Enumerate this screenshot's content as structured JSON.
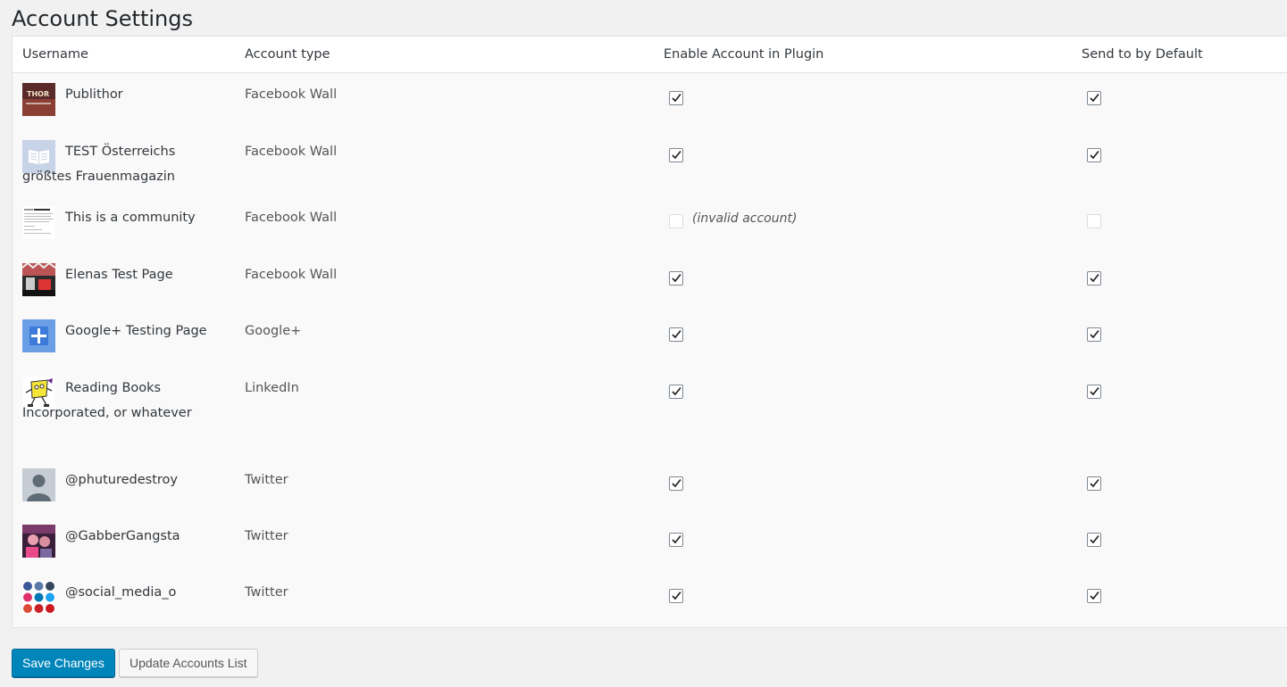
{
  "page": {
    "title": "Account Settings"
  },
  "table": {
    "headers": {
      "username": "Username",
      "account_type": "Account type",
      "enable": "Enable Account in Plugin",
      "default": "Send to by Default"
    },
    "rows": [
      {
        "name": "Publithor",
        "type": "Facebook Wall",
        "enabled": true,
        "default": true,
        "avatar": "thor-poster-avatar"
      },
      {
        "name": "TEST Österreichs größtes Frauenmagazin",
        "type": "Facebook Wall",
        "enabled": true,
        "default": true,
        "avatar": "book-icon-avatar"
      },
      {
        "name": "This is a community",
        "type": "Facebook Wall",
        "enabled": false,
        "default": false,
        "invalid_note": "(invalid account)",
        "avatar": "document-page-avatar"
      },
      {
        "name": "Elenas Test Page",
        "type": "Facebook Wall",
        "enabled": true,
        "default": true,
        "avatar": "photo-avatar"
      },
      {
        "name": "Google+ Testing Page",
        "type": "Google+",
        "enabled": true,
        "default": true,
        "avatar": "blue-cross-avatar"
      },
      {
        "name": "Reading Books Incorporated, or whatever",
        "type": "LinkedIn",
        "enabled": true,
        "default": true,
        "avatar": "cartoon-book-avatar"
      },
      {
        "name": "@phuturedestroy",
        "type": "Twitter",
        "enabled": true,
        "default": true,
        "avatar": "default-person-avatar"
      },
      {
        "name": "@GabberGangsta",
        "type": "Twitter",
        "enabled": true,
        "default": true,
        "avatar": "photo-people-avatar"
      },
      {
        "name": "@social_media_o",
        "type": "Twitter",
        "enabled": true,
        "default": true,
        "avatar": "social-icons-avatar"
      }
    ]
  },
  "actions": {
    "save_label": "Save Changes",
    "update_label": "Update Accounts List"
  },
  "colors": {
    "primary": "#0085ba",
    "table_bg": "#f9f9f9",
    "page_bg": "#f1f1f1"
  }
}
